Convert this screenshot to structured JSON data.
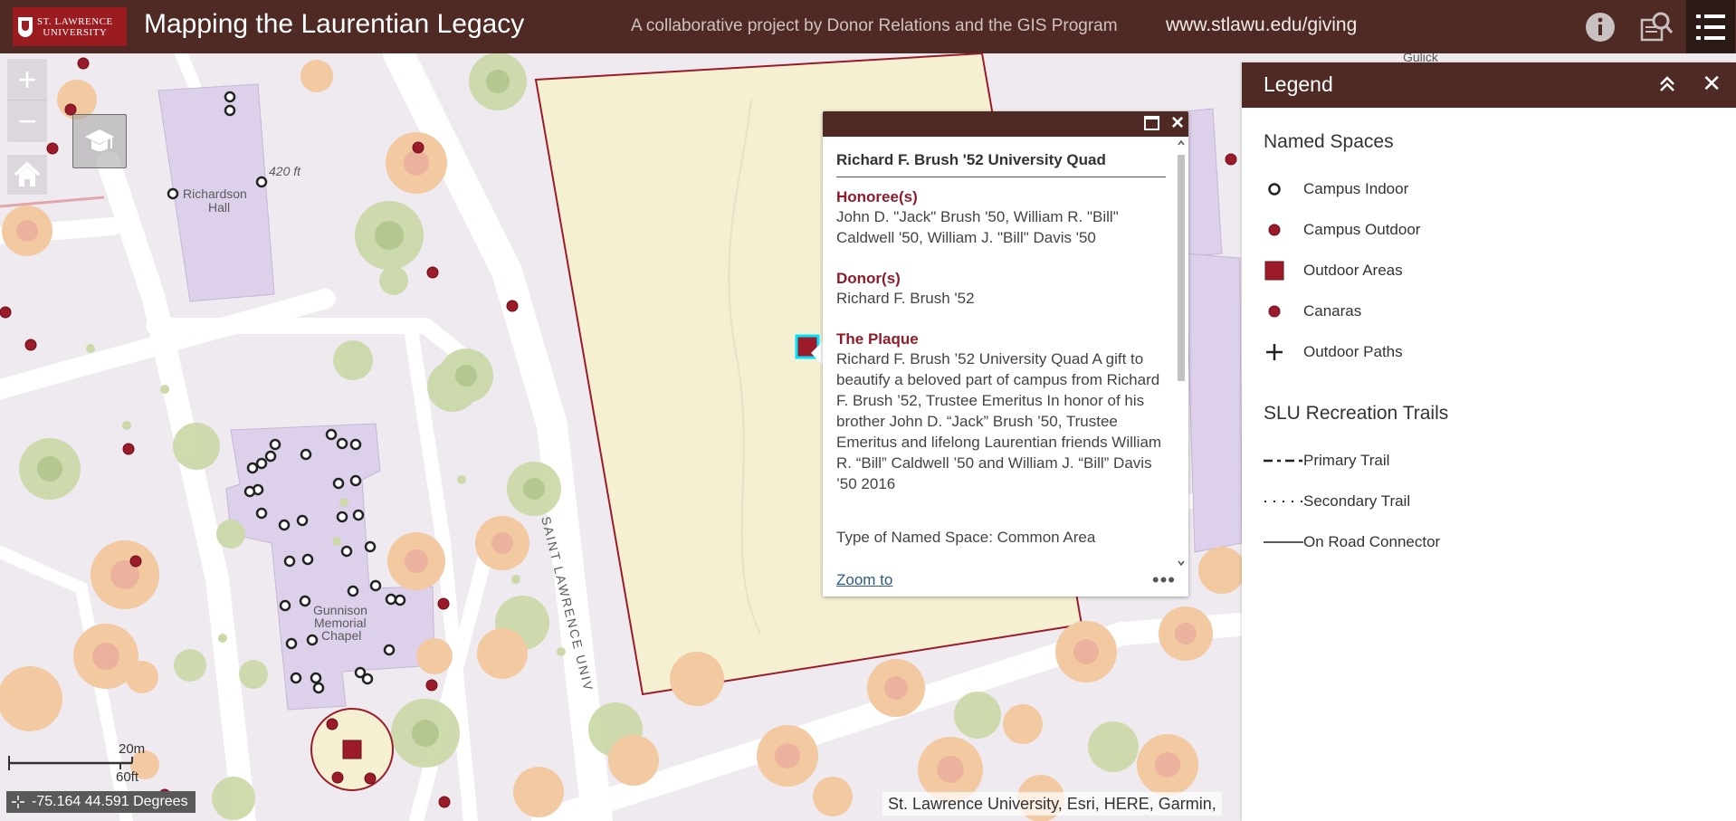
{
  "header": {
    "logo_line1": "ST. LAWRENCE",
    "logo_line2": "UNIVERSITY",
    "title": "Mapping the Laurentian Legacy",
    "subtitle": "A collaborative project by Donor Relations and the GIS Program",
    "url": "www.stlawu.edu/giving",
    "icons": [
      "info-icon",
      "query-icon",
      "legend-list-icon"
    ]
  },
  "map": {
    "labels": {
      "richardson": "Richardson",
      "richardson2": "Hall",
      "gunnison1": "Gunnison",
      "gunnison2": "Memorial",
      "gunnison3": "Chapel",
      "elevation": "420 ft",
      "road": "SAINT LAWRENCE UNIV",
      "gulick": "Gulick"
    },
    "zoom_in": "+",
    "zoom_out": "−",
    "scale_metric": "20m",
    "scale_imperial": "60ft",
    "coordinates": "-75.164 44.591 Degrees",
    "attribution": "St. Lawrence University, Esri, HERE, Garmin,"
  },
  "popup": {
    "title": "Richard F. Brush '52 University Quad",
    "honorees_label": "Honoree(s)",
    "honorees_value": "John D. \"Jack\" Brush '50, William R. \"Bill\" Caldwell '50, William J. \"Bill\" Davis '50",
    "donors_label": "Donor(s)",
    "donors_value": "Richard F. Brush '52",
    "plaque_label": "The Plaque",
    "plaque_value": "Richard F. Brush ’52 University Quad A gift to beautify a beloved part of campus from Richard F. Brush ’52, Trustee Emeritus In honor of his brother John D. “Jack” Brush ’50, Trustee Emeritus and lifelong Laurentian friends William R. “Bill” Caldwell ’50 and William J. “Bill” Davis ’50 2016",
    "type": "Type of Named Space: Common Area",
    "zoom_to": "Zoom to",
    "more": "•••"
  },
  "legend": {
    "title": "Legend",
    "section1": "Named Spaces",
    "items1": [
      "Campus Indoor",
      "Campus Outdoor",
      "Outdoor Areas",
      "Canaras",
      "Outdoor Paths"
    ],
    "section2": "SLU Recreation Trails",
    "items2": [
      "Primary Trail",
      "Secondary Trail",
      "On Road Connector"
    ]
  },
  "colors": {
    "brand": "#4f2a24",
    "logo_red": "#9a1b20",
    "point_red": "#9c1b2a",
    "label_red": "#8f1c2a",
    "building": "#ddd0ea",
    "quad_fill": "#f5f0d2",
    "highlight": "#00e5ff"
  }
}
